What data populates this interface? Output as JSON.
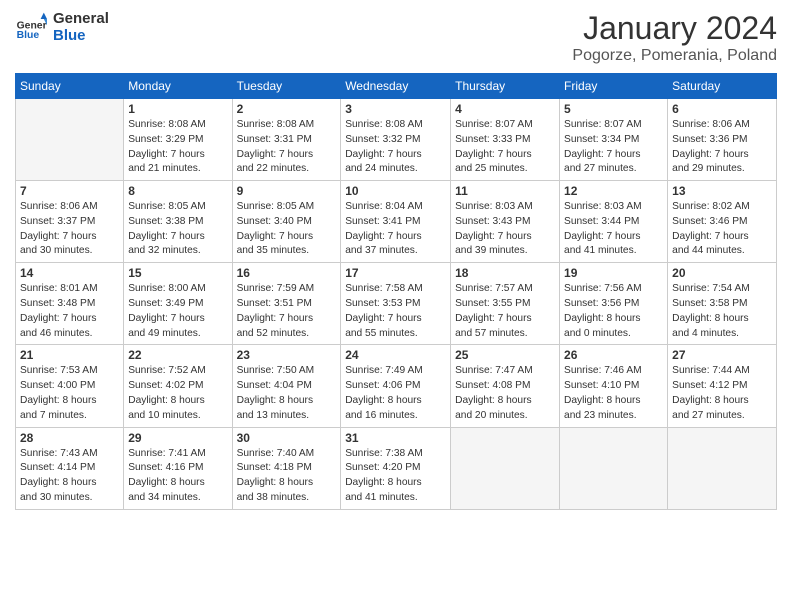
{
  "header": {
    "logo_general": "General",
    "logo_blue": "Blue",
    "month_title": "January 2024",
    "location": "Pogorze, Pomerania, Poland"
  },
  "weekdays": [
    "Sunday",
    "Monday",
    "Tuesday",
    "Wednesday",
    "Thursday",
    "Friday",
    "Saturday"
  ],
  "weeks": [
    [
      {
        "day": "",
        "empty": true
      },
      {
        "day": "1",
        "sunrise": "Sunrise: 8:08 AM",
        "sunset": "Sunset: 3:29 PM",
        "daylight": "Daylight: 7 hours and 21 minutes."
      },
      {
        "day": "2",
        "sunrise": "Sunrise: 8:08 AM",
        "sunset": "Sunset: 3:31 PM",
        "daylight": "Daylight: 7 hours and 22 minutes."
      },
      {
        "day": "3",
        "sunrise": "Sunrise: 8:08 AM",
        "sunset": "Sunset: 3:32 PM",
        "daylight": "Daylight: 7 hours and 24 minutes."
      },
      {
        "day": "4",
        "sunrise": "Sunrise: 8:07 AM",
        "sunset": "Sunset: 3:33 PM",
        "daylight": "Daylight: 7 hours and 25 minutes."
      },
      {
        "day": "5",
        "sunrise": "Sunrise: 8:07 AM",
        "sunset": "Sunset: 3:34 PM",
        "daylight": "Daylight: 7 hours and 27 minutes."
      },
      {
        "day": "6",
        "sunrise": "Sunrise: 8:06 AM",
        "sunset": "Sunset: 3:36 PM",
        "daylight": "Daylight: 7 hours and 29 minutes."
      }
    ],
    [
      {
        "day": "7",
        "sunrise": "Sunrise: 8:06 AM",
        "sunset": "Sunset: 3:37 PM",
        "daylight": "Daylight: 7 hours and 30 minutes."
      },
      {
        "day": "8",
        "sunrise": "Sunrise: 8:05 AM",
        "sunset": "Sunset: 3:38 PM",
        "daylight": "Daylight: 7 hours and 32 minutes."
      },
      {
        "day": "9",
        "sunrise": "Sunrise: 8:05 AM",
        "sunset": "Sunset: 3:40 PM",
        "daylight": "Daylight: 7 hours and 35 minutes."
      },
      {
        "day": "10",
        "sunrise": "Sunrise: 8:04 AM",
        "sunset": "Sunset: 3:41 PM",
        "daylight": "Daylight: 7 hours and 37 minutes."
      },
      {
        "day": "11",
        "sunrise": "Sunrise: 8:03 AM",
        "sunset": "Sunset: 3:43 PM",
        "daylight": "Daylight: 7 hours and 39 minutes."
      },
      {
        "day": "12",
        "sunrise": "Sunrise: 8:03 AM",
        "sunset": "Sunset: 3:44 PM",
        "daylight": "Daylight: 7 hours and 41 minutes."
      },
      {
        "day": "13",
        "sunrise": "Sunrise: 8:02 AM",
        "sunset": "Sunset: 3:46 PM",
        "daylight": "Daylight: 7 hours and 44 minutes."
      }
    ],
    [
      {
        "day": "14",
        "sunrise": "Sunrise: 8:01 AM",
        "sunset": "Sunset: 3:48 PM",
        "daylight": "Daylight: 7 hours and 46 minutes."
      },
      {
        "day": "15",
        "sunrise": "Sunrise: 8:00 AM",
        "sunset": "Sunset: 3:49 PM",
        "daylight": "Daylight: 7 hours and 49 minutes."
      },
      {
        "day": "16",
        "sunrise": "Sunrise: 7:59 AM",
        "sunset": "Sunset: 3:51 PM",
        "daylight": "Daylight: 7 hours and 52 minutes."
      },
      {
        "day": "17",
        "sunrise": "Sunrise: 7:58 AM",
        "sunset": "Sunset: 3:53 PM",
        "daylight": "Daylight: 7 hours and 55 minutes."
      },
      {
        "day": "18",
        "sunrise": "Sunrise: 7:57 AM",
        "sunset": "Sunset: 3:55 PM",
        "daylight": "Daylight: 7 hours and 57 minutes."
      },
      {
        "day": "19",
        "sunrise": "Sunrise: 7:56 AM",
        "sunset": "Sunset: 3:56 PM",
        "daylight": "Daylight: 8 hours and 0 minutes."
      },
      {
        "day": "20",
        "sunrise": "Sunrise: 7:54 AM",
        "sunset": "Sunset: 3:58 PM",
        "daylight": "Daylight: 8 hours and 4 minutes."
      }
    ],
    [
      {
        "day": "21",
        "sunrise": "Sunrise: 7:53 AM",
        "sunset": "Sunset: 4:00 PM",
        "daylight": "Daylight: 8 hours and 7 minutes."
      },
      {
        "day": "22",
        "sunrise": "Sunrise: 7:52 AM",
        "sunset": "Sunset: 4:02 PM",
        "daylight": "Daylight: 8 hours and 10 minutes."
      },
      {
        "day": "23",
        "sunrise": "Sunrise: 7:50 AM",
        "sunset": "Sunset: 4:04 PM",
        "daylight": "Daylight: 8 hours and 13 minutes."
      },
      {
        "day": "24",
        "sunrise": "Sunrise: 7:49 AM",
        "sunset": "Sunset: 4:06 PM",
        "daylight": "Daylight: 8 hours and 16 minutes."
      },
      {
        "day": "25",
        "sunrise": "Sunrise: 7:47 AM",
        "sunset": "Sunset: 4:08 PM",
        "daylight": "Daylight: 8 hours and 20 minutes."
      },
      {
        "day": "26",
        "sunrise": "Sunrise: 7:46 AM",
        "sunset": "Sunset: 4:10 PM",
        "daylight": "Daylight: 8 hours and 23 minutes."
      },
      {
        "day": "27",
        "sunrise": "Sunrise: 7:44 AM",
        "sunset": "Sunset: 4:12 PM",
        "daylight": "Daylight: 8 hours and 27 minutes."
      }
    ],
    [
      {
        "day": "28",
        "sunrise": "Sunrise: 7:43 AM",
        "sunset": "Sunset: 4:14 PM",
        "daylight": "Daylight: 8 hours and 30 minutes."
      },
      {
        "day": "29",
        "sunrise": "Sunrise: 7:41 AM",
        "sunset": "Sunset: 4:16 PM",
        "daylight": "Daylight: 8 hours and 34 minutes."
      },
      {
        "day": "30",
        "sunrise": "Sunrise: 7:40 AM",
        "sunset": "Sunset: 4:18 PM",
        "daylight": "Daylight: 8 hours and 38 minutes."
      },
      {
        "day": "31",
        "sunrise": "Sunrise: 7:38 AM",
        "sunset": "Sunset: 4:20 PM",
        "daylight": "Daylight: 8 hours and 41 minutes."
      },
      {
        "day": "",
        "empty": true
      },
      {
        "day": "",
        "empty": true
      },
      {
        "day": "",
        "empty": true
      }
    ]
  ]
}
